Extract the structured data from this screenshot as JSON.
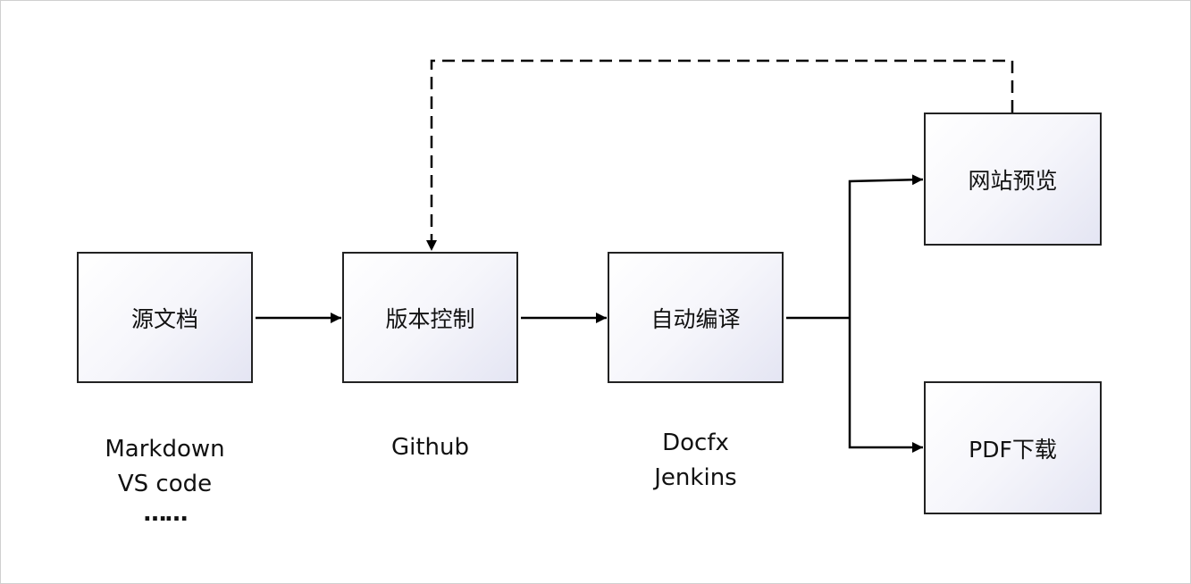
{
  "nodes": {
    "source": "源文档",
    "vcs": "版本控制",
    "build": "自动编译",
    "preview": "网站预览",
    "pdf": "PDF下载"
  },
  "captions": {
    "source": [
      "Markdown",
      "VS code",
      "……"
    ],
    "vcs": [
      "Github"
    ],
    "build": [
      "Docfx",
      "Jenkins"
    ]
  }
}
